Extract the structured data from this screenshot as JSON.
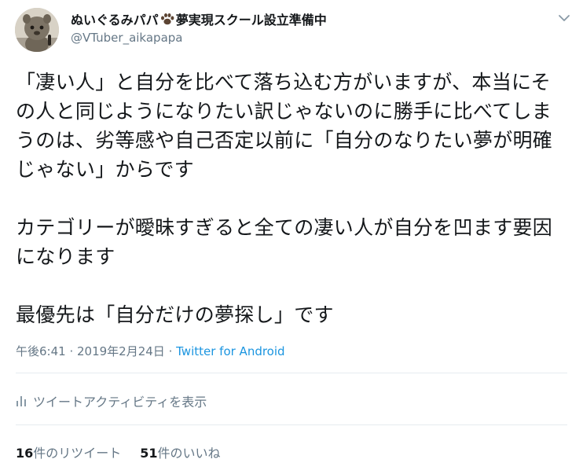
{
  "author": {
    "display_name": "ぬいぐるみパパ",
    "display_name_suffix": "夢実現スクール設立準備中",
    "handle": "@VTuber_aikapapa",
    "avatar_icon": "avatar-plush-doll"
  },
  "tweet": {
    "paragraphs": [
      "「凄い人」と自分を比べて落ち込む方がいますが、本当にその人と同じようになりたい訳じゃないのに勝手に比べてしまうのは、劣等感や自己否定以前に「自分のなりたい夢が明確じゃない」からです",
      "カテゴリーが曖昧すぎると全ての凄い人が自分を凹ます要因になります",
      "最優先は「自分だけの夢探し」です"
    ]
  },
  "meta": {
    "time": "午後6:41",
    "separator": " · ",
    "date": "2019年2月24日",
    "source": "Twitter for Android"
  },
  "activity": {
    "label": "ツイートアクティビティを表示",
    "icon": "bar-chart-icon"
  },
  "stats": {
    "retweets_count": "16",
    "retweets_label": "件のリツイート",
    "likes_count": "51",
    "likes_label": "件のいいね"
  },
  "colors": {
    "text": "#14171a",
    "secondary": "#657786",
    "link": "#1b95e0",
    "divider": "#e6ecf0"
  }
}
